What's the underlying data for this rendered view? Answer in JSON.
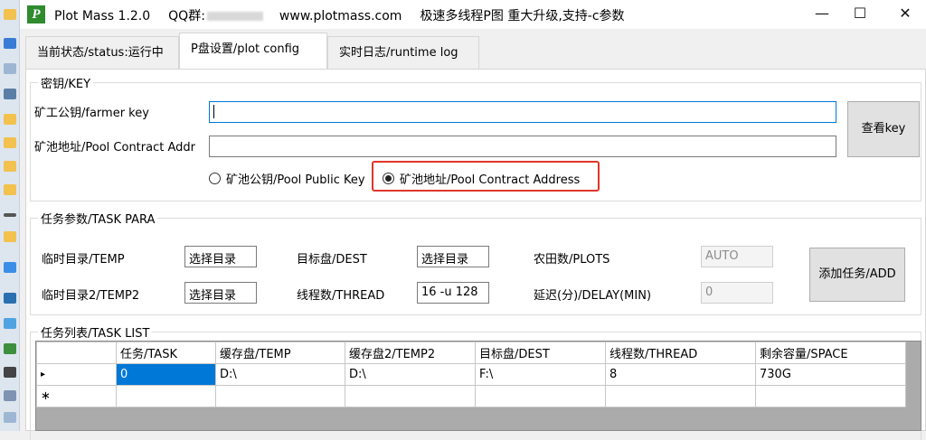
{
  "window": {
    "app_name": "Plot Mass 1.2.0",
    "qq_label": "QQ群:",
    "website": "www.plotmass.com",
    "announcement": "极速多线程P图 重大升级,支持-c参数",
    "logo_letter": "P",
    "minimize": "—",
    "maximize": "☐",
    "close": "✕"
  },
  "tabs": [
    {
      "label": "当前状态/status:运行中",
      "active": false
    },
    {
      "label": "P盘设置/plot config",
      "active": true
    },
    {
      "label": "实时日志/runtime log",
      "active": false
    }
  ],
  "key_group": {
    "legend": "密钥/KEY",
    "farmer_key_label": "矿工公钥/farmer key",
    "farmer_key_value": "",
    "pool_contract_label": "矿池地址/Pool Contract Addr",
    "pool_contract_value": "",
    "view_key_button": "查看key",
    "radio_pool_public_key": "矿池公钥/Pool Public Key",
    "radio_pool_contract_address": "矿池地址/Pool Contract Address",
    "selected_radio": "pool_contract_address"
  },
  "task_para": {
    "legend": "任务参数/TASK PARA",
    "temp_label": "临时目录/TEMP",
    "temp_value": "选择目录",
    "temp2_label": "临时目录2/TEMP2",
    "temp2_value": "选择目录",
    "dest_label": "目标盘/DEST",
    "dest_value": "选择目录",
    "thread_label": "线程数/THREAD",
    "thread_value": "16 -u 128",
    "plots_label": "农田数/PLOTS",
    "plots_value": "AUTO",
    "delay_label": "延迟(分)/DELAY(MIN)",
    "delay_value": "0",
    "add_button": "添加任务/ADD"
  },
  "task_list": {
    "legend": "任务列表/TASK LIST",
    "columns": [
      "任务/TASK",
      "缓存盘/TEMP",
      "缓存盘2/TEMP2",
      "目标盘/DEST",
      "线程数/THREAD",
      "剩余容量/SPACE"
    ],
    "rows": [
      {
        "marker": "▸",
        "cells": [
          "0",
          "D:\\",
          "D:\\",
          "F:\\",
          "8",
          "730G"
        ]
      },
      {
        "marker": "∗",
        "cells": [
          "",
          "",
          "",
          "",
          "",
          ""
        ]
      }
    ]
  },
  "colors": {
    "accent": "#0078d7",
    "highlight_box": "#e0352b",
    "logo_green": "#2e8b2e"
  }
}
